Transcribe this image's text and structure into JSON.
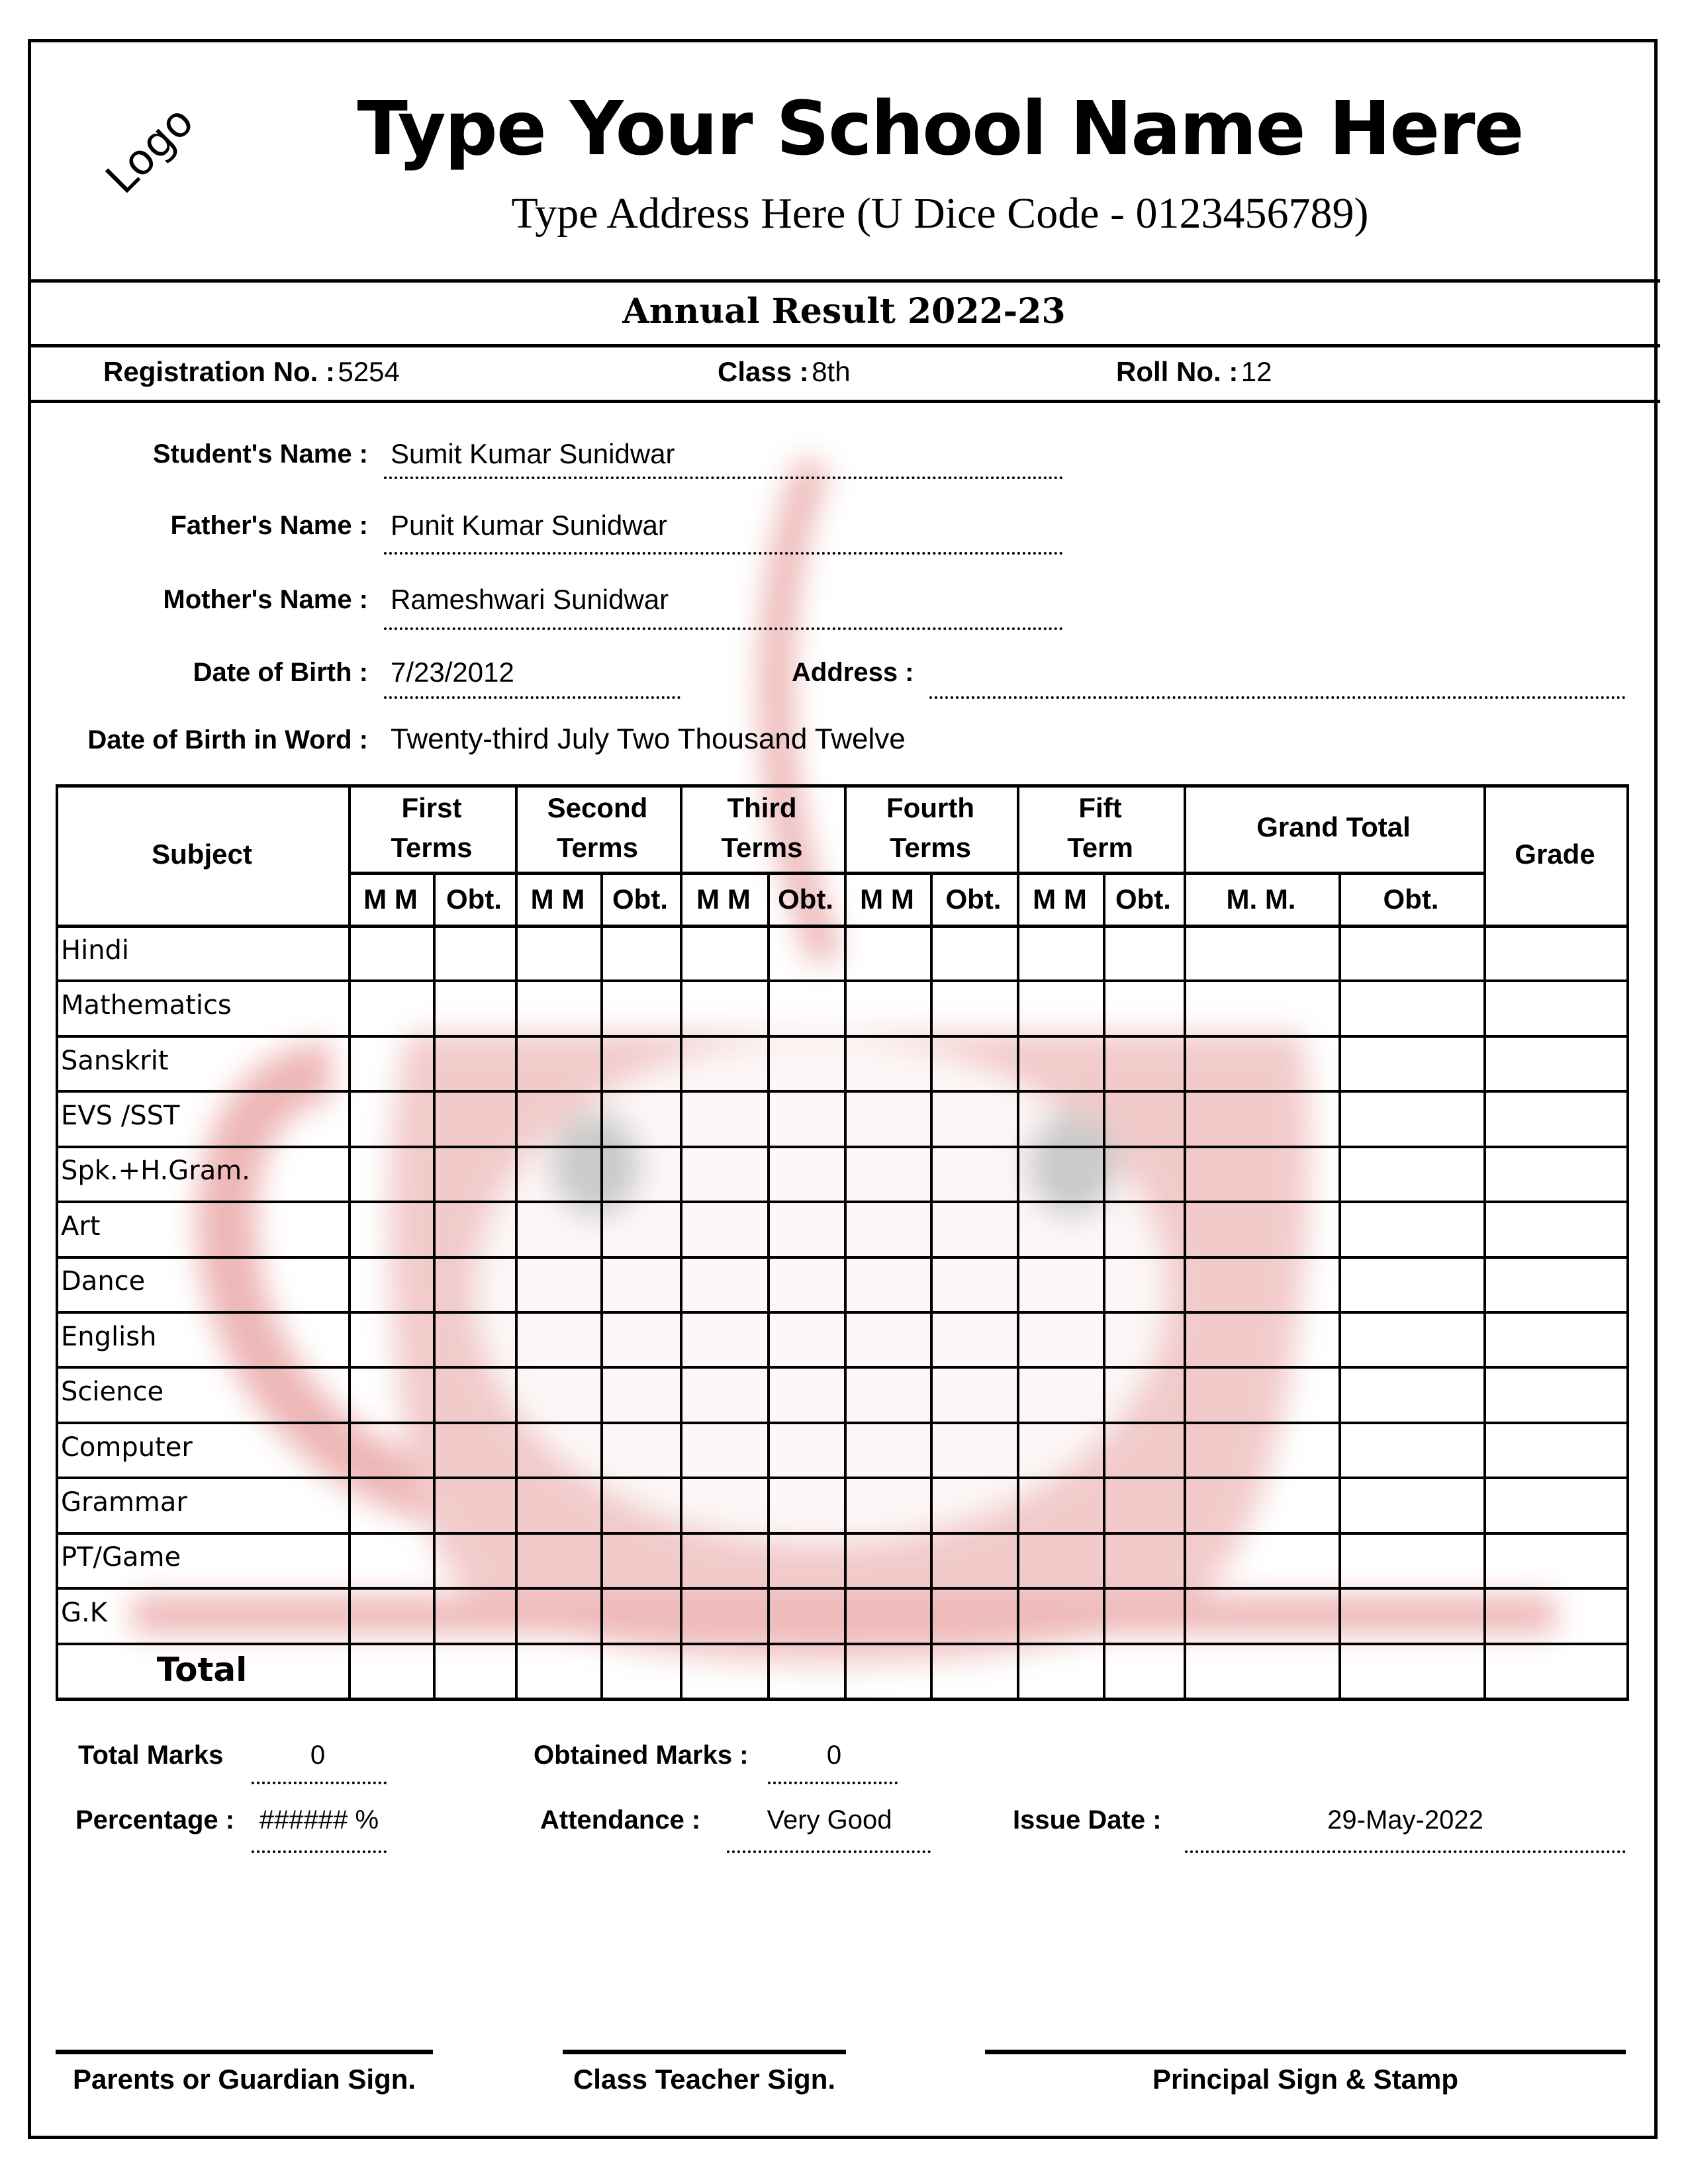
{
  "header": {
    "logo_text": "Logo",
    "school_name": "Type Your School Name Here",
    "address": "Type Address Here (U Dice Code - 0123456789)"
  },
  "title": "Annual Result 2022-23",
  "registration": {
    "reg_label": "Registration No. :",
    "reg_value": "5254",
    "class_label": "Class :",
    "class_value": "8th",
    "roll_label": "Roll No. :",
    "roll_value": "12"
  },
  "student": {
    "name_label": "Student's Name :",
    "name_value": "Sumit Kumar Sunidwar",
    "father_label": "Father's Name :",
    "father_value": "Punit Kumar Sunidwar",
    "mother_label": "Mother's Name :",
    "mother_value": "Rameshwari Sunidwar",
    "dob_label": "Date of Birth :",
    "dob_value": "7/23/2012",
    "address_label": "Address :",
    "address_value": "",
    "dob_word_label": "Date of Birth in Word :",
    "dob_word_value": "Twenty-third July Two Thousand Twelve"
  },
  "table": {
    "subject_header": "Subject",
    "terms": [
      {
        "line1": "First",
        "line2": "Terms"
      },
      {
        "line1": "Second",
        "line2": "Terms"
      },
      {
        "line1": "Third",
        "line2": "Terms"
      },
      {
        "line1": "Fourth",
        "line2": "Terms"
      },
      {
        "line1": "Fift",
        "line2": "Term"
      }
    ],
    "mm_label": "M M",
    "obt_label": "Obt.",
    "grand_total_header": "Grand Total",
    "grand_mm_label": "M. M.",
    "grand_obt_label": "Obt.",
    "grade_header": "Grade",
    "subjects": [
      "Hindi",
      "Mathematics",
      "Sanskrit",
      "EVS /SST",
      "Spk.+H.Gram.",
      "Art",
      "Dance",
      "English",
      "Science",
      "Computer",
      "Grammar",
      "PT/Game",
      "G.K"
    ],
    "total_label": "Total"
  },
  "summary": {
    "total_marks_label": "Total Marks",
    "total_marks_value": "0",
    "obtained_label": "Obtained Marks :",
    "obtained_value": "0",
    "percentage_label": "Percentage :",
    "percentage_value": "###### %",
    "attendance_label": "Attendance :",
    "attendance_value": "Very Good",
    "issue_date_label": "Issue Date :",
    "issue_date_value": "29-May-2022"
  },
  "signatures": {
    "parent": "Parents or Guardian Sign.",
    "teacher": "Class Teacher Sign.",
    "principal": "Principal Sign & Stamp"
  },
  "colors": {
    "watermark": "#e88a8a"
  }
}
